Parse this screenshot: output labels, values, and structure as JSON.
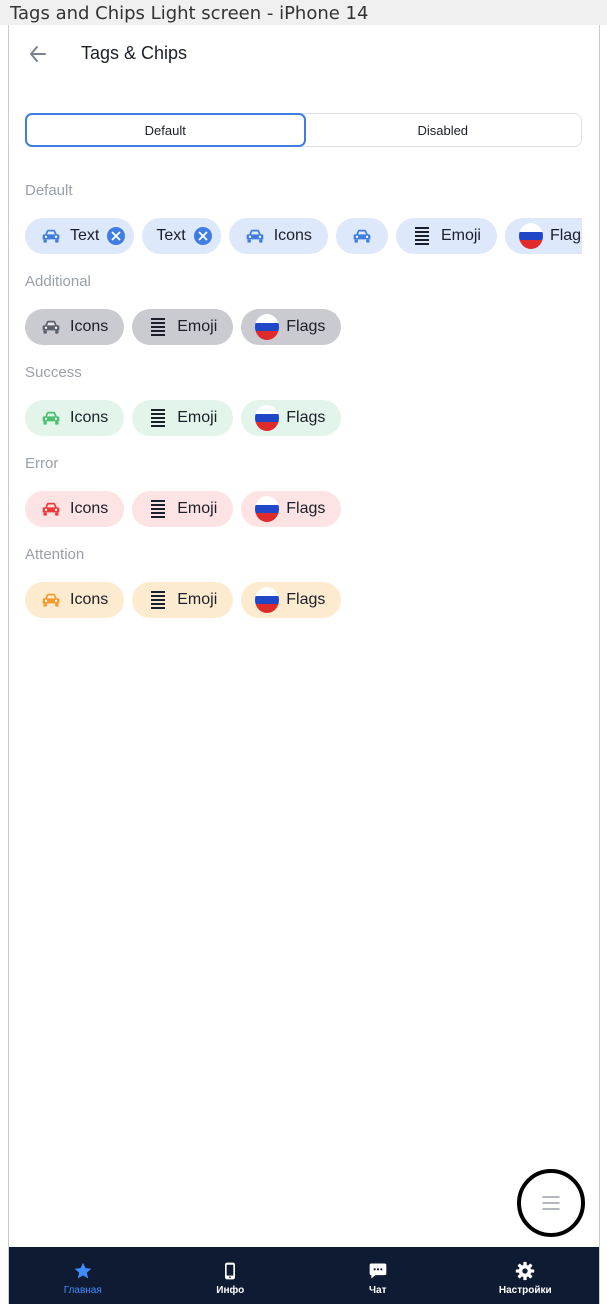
{
  "frame": {
    "title": "Tags and Chips Light screen - iPhone 14"
  },
  "header": {
    "title": "Tags & Chips"
  },
  "segments": [
    {
      "label": "Default",
      "active": true
    },
    {
      "label": "Disabled",
      "active": false
    }
  ],
  "sections": {
    "default": {
      "label": "Default",
      "chips": [
        {
          "text": "Text",
          "icon": "car-icon",
          "removable": true
        },
        {
          "text": "Text",
          "removable": true
        },
        {
          "text": "Icons",
          "icon": "car-icon"
        },
        {
          "icon": "car-icon"
        },
        {
          "text": "Emoji",
          "icon": "emoji-icon"
        },
        {
          "text": "Flags",
          "icon": "russia-flag-icon"
        }
      ]
    },
    "additional": {
      "label": "Additional",
      "chips": [
        {
          "text": "Icons",
          "icon": "car-icon"
        },
        {
          "text": "Emoji",
          "icon": "emoji-icon"
        },
        {
          "text": "Flags",
          "icon": "russia-flag-icon"
        }
      ]
    },
    "success": {
      "label": "Success",
      "chips": [
        {
          "text": "Icons",
          "icon": "car-icon"
        },
        {
          "text": "Emoji",
          "icon": "emoji-icon"
        },
        {
          "text": "Flags",
          "icon": "russia-flag-icon"
        }
      ]
    },
    "error": {
      "label": "Error",
      "chips": [
        {
          "text": "Icons",
          "icon": "car-icon"
        },
        {
          "text": "Emoji",
          "icon": "emoji-icon"
        },
        {
          "text": "Flags",
          "icon": "russia-flag-icon"
        }
      ]
    },
    "attention": {
      "label": "Attention",
      "chips": [
        {
          "text": "Icons",
          "icon": "car-icon"
        },
        {
          "text": "Emoji",
          "icon": "emoji-icon"
        },
        {
          "text": "Flags",
          "icon": "russia-flag-icon"
        }
      ]
    }
  },
  "colors": {
    "default_bg": "#dde8fb",
    "default_icon": "#3f7de0",
    "additional_bg": "#c9cbd1",
    "additional_icon": "#5b606b",
    "success_bg": "#e3f5ea",
    "success_icon": "#48c06d",
    "error_bg": "#fde3e3",
    "error_icon": "#ef3a3a",
    "attention_bg": "#fdebcf",
    "attention_icon": "#f59a2a",
    "accent": "#3f7de0",
    "tabbar_bg": "#0f1b33"
  },
  "fab": {
    "icon": "menu-icon"
  },
  "tabbar": {
    "items": [
      {
        "label": "Главная",
        "icon": "star-icon",
        "active": true
      },
      {
        "label": "Инфо",
        "icon": "phone-icon",
        "active": false
      },
      {
        "label": "Чат",
        "icon": "chat-icon",
        "active": false
      },
      {
        "label": "Настройки",
        "icon": "gear-icon",
        "active": false
      }
    ]
  }
}
